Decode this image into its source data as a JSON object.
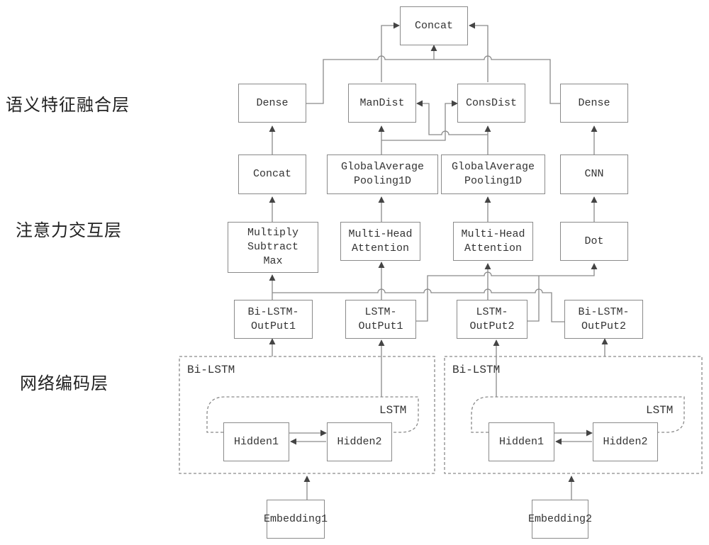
{
  "layers": {
    "fusion": "语义特征融合层",
    "attention": "注意力交互层",
    "encoding": "网络编码层"
  },
  "nodes": {
    "concat_top": "Concat",
    "dense_left": "Dense",
    "mandist": "ManDist",
    "consdist": "ConsDist",
    "dense_right": "Dense",
    "concat_left": "Concat",
    "gap1": "GlobalAverage\nPooling1D",
    "gap2": "GlobalAverage\nPooling1D",
    "cnn": "CNN",
    "msm": "Multiply\nSubtract\nMax",
    "mha1": "Multi-Head\nAttention",
    "mha2": "Multi-Head\nAttention",
    "dot": "Dot",
    "bilstm_out1": "Bi-LSTM-\nOutPut1",
    "lstm_out1": "LSTM-\nOutPut1",
    "lstm_out2": "LSTM-\nOutPut2",
    "bilstm_out2": "Bi-LSTM-\nOutPut2",
    "hidden1_a": "Hidden1",
    "hidden2_a": "Hidden2",
    "hidden1_b": "Hidden1",
    "hidden2_b": "Hidden2",
    "embedding1": "Embedding1",
    "embedding2": "Embedding2"
  },
  "groups": {
    "bilstm_left": "Bi-LSTM",
    "lstm_left": "LSTM",
    "bilstm_right": "Bi-LSTM",
    "lstm_right": "LSTM"
  },
  "colors": {
    "line": "#8a8a8a",
    "arrow": "#444444"
  }
}
